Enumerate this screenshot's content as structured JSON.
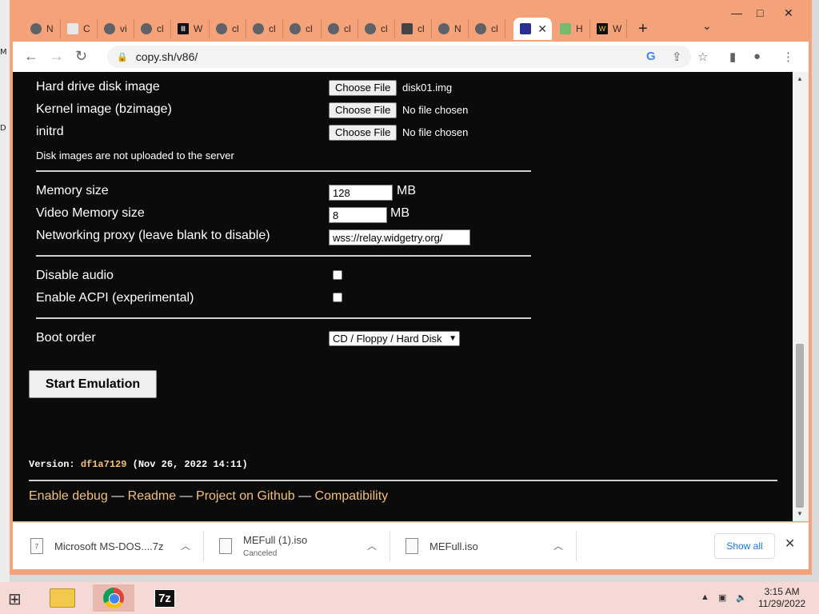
{
  "window": {
    "tabs": [
      {
        "label": "N",
        "icon": "chrome-icon"
      },
      {
        "label": "C",
        "icon": "document-icon"
      },
      {
        "label": "vi",
        "icon": "chrome-icon"
      },
      {
        "label": "cl",
        "icon": "globe-icon"
      },
      {
        "label": "W",
        "icon": "bank-icon"
      },
      {
        "label": "cl",
        "icon": "globe-icon"
      },
      {
        "label": "cl",
        "icon": "globe-icon"
      },
      {
        "label": "cl",
        "icon": "chrome-icon"
      },
      {
        "label": "cl",
        "icon": "globe-icon"
      },
      {
        "label": "cl",
        "icon": "globe-icon"
      },
      {
        "label": "cl",
        "icon": "puzzle-icon"
      },
      {
        "label": "N",
        "icon": "chrome-icon"
      },
      {
        "label": "cl",
        "icon": "globe-icon"
      },
      {
        "label": "",
        "icon": "invader-icon",
        "active": true
      },
      {
        "label": "H",
        "icon": "image-icon"
      },
      {
        "label": "W",
        "icon": "w-logo-icon"
      }
    ],
    "new_tab_glyph": "+",
    "tab_search_glyph": "⌄",
    "controls": {
      "minimize": "—",
      "maximize": "□",
      "close": "✕"
    }
  },
  "toolbar": {
    "url": "copy.sh/v86/",
    "back": "←",
    "forward": "→",
    "reload": "↻",
    "icons": [
      "google-icon",
      "share-icon",
      "star-icon",
      "sidepanel-icon",
      "profile-icon",
      "menu-icon"
    ]
  },
  "page": {
    "hdd_label": "Hard drive disk image",
    "hdd_button": "Choose File",
    "hdd_status": "disk01.img",
    "kernel_label": "Kernel image (bzimage)",
    "kernel_button": "Choose File",
    "kernel_status": "No file chosen",
    "initrd_label": "initrd",
    "initrd_button": "Choose File",
    "initrd_status": "No file chosen",
    "disk_note": "Disk images are not uploaded to the server",
    "memory_label": "Memory size",
    "memory_value": "128",
    "memory_unit": "MB",
    "vram_label": "Video Memory size",
    "vram_value": "8",
    "vram_unit": "MB",
    "proxy_label": "Networking proxy (leave blank to disable)",
    "proxy_value": "wss://relay.widgetry.org/",
    "audio_label": "Disable audio",
    "audio_checked": false,
    "acpi_label": "Enable ACPI (experimental)",
    "acpi_checked": false,
    "boot_label": "Boot order",
    "boot_value": "CD / Floppy / Hard Disk",
    "start_button": "Start Emulation",
    "version_prefix": "Version: ",
    "version_hash": "df1a7129",
    "version_date": " (Nov 26, 2022 14:11)",
    "footer": {
      "debug": "Enable debug",
      "readme": "Readme",
      "github": "Project on Github",
      "compat": "Compatibility",
      "sep": " — "
    }
  },
  "downloads": {
    "items": [
      {
        "name": "Microsoft MS-DOS....7z",
        "sub": ""
      },
      {
        "name": "MEFull (1).iso",
        "sub": "Canceled"
      },
      {
        "name": "MEFull.iso",
        "sub": ""
      }
    ],
    "show_all": "Show all",
    "close": "✕"
  },
  "taskbar": {
    "time": "3:15 AM",
    "date": "11/29/2022",
    "apps": [
      "file-explorer-icon",
      "chrome-icon",
      "7zip-icon"
    ],
    "sevenzip_label": "7z"
  },
  "colors": {
    "chrome_frame": "#f4a27a",
    "page_bg": "#0b0b0b",
    "link": "#f0c080",
    "taskbar": "#f5d9d4"
  }
}
